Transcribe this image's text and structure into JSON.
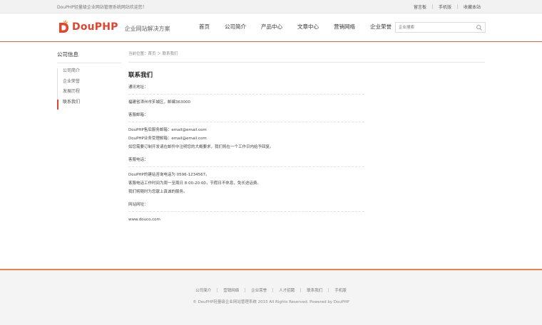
{
  "topbar": {
    "welcome": "DouPHP轻量级企业网站管理系统网站欢迎您！",
    "links": [
      "留言板",
      "手机版",
      "收藏本站"
    ]
  },
  "header": {
    "brand": "DouPHP",
    "slogan": "企业网站解决方案",
    "nav": [
      "首页",
      "公司简介",
      "产品中心",
      "文章中心",
      "营销网络",
      "企业荣誉"
    ],
    "search_placeholder": "企业搜索",
    "brand_color": "#e0452f"
  },
  "sidebar": {
    "title": "公司信息",
    "items": [
      "公司简介",
      "企业荣誉",
      "发展历程",
      "联系我们"
    ],
    "active_index": 3
  },
  "main": {
    "breadcrumb": "当前位置：首页 ＞ 联系我们",
    "title": "联系我们",
    "address_label": "通讯地址：",
    "address": "福建省漳州市芗城区，邮编363000",
    "email_label": "客服邮箱：",
    "email_lines": [
      "DouPHP售后服务邮箱：email@email.com",
      "DouPHP业务受理邮箱：email@email.com",
      "如您需要订制开发请在邮件中注明您的大概要求，我们将在一个工作日内给予回复。"
    ],
    "phone_label": "客服电话：",
    "phone_lines": [
      "DouPHP的建站咨询电话为 0596-1234567。",
      "客服电话工作时间为周一至周日 8:00-20:00，节假日不休息，免长途话费。",
      "我们将随时为您献上真诚的服务。"
    ],
    "website_label": "网站网址：",
    "website": "www.douco.com"
  },
  "footer": {
    "links": [
      "公司简介",
      "营销网络",
      "企业荣誉",
      "人才招聘",
      "联系我们",
      "手机版"
    ],
    "copyright": "© DouPHP轻量级企业网站管理系统 2015 All Rights Reserved. Powered by DouPHP"
  }
}
